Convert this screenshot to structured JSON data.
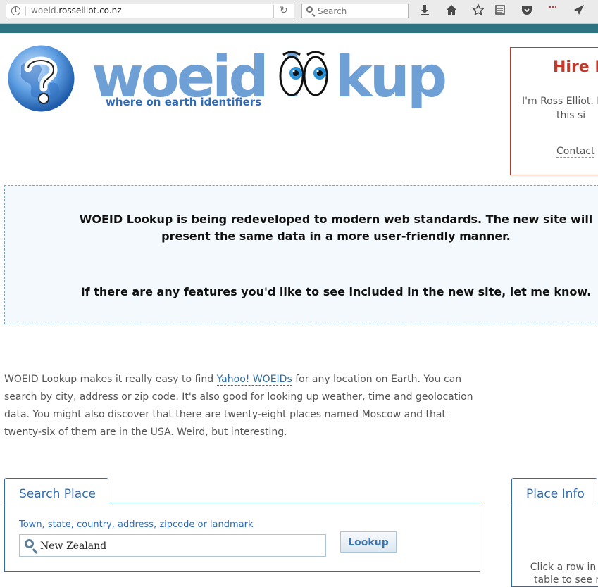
{
  "browser": {
    "url_prefix": "woeid.",
    "url_domain": "rosselliot.co.nz",
    "search_placeholder": "Search",
    "toolbar_icons": [
      "download-icon",
      "home-icon",
      "bookmark-star-icon",
      "reader-view-icon",
      "pocket-icon",
      "extension-icon",
      "send-icon"
    ]
  },
  "header": {
    "logo_word1": "woeid",
    "logo_word2": "kup",
    "tagline": "where on earth identifiers"
  },
  "hire": {
    "title": "Hire M",
    "line1": "I'm Ross Elliot. I",
    "line2": "this si",
    "contact": "Contact"
  },
  "notice": {
    "line1": "WOEID Lookup is being redeveloped to modern web standards. The new site will",
    "line2": "present the same data in a more user-friendly manner.",
    "line3": "If there are any features you'd like to see included in the new site, let me know."
  },
  "intro": {
    "before_link": "WOEID Lookup makes it really easy to find ",
    "link": "Yahoo! WOEIDs",
    "after_link": " for any location on Earth. You can search by city, address or zip code. It's also good for looking up weather, time and geolocation data. You might also discover that there are twenty-eight places named Moscow and that twenty-six of them are in the USA. Weird, but interesting."
  },
  "search": {
    "tab_label": "Search Place",
    "field_label": "Town, state, country, address, zipcode or landmark",
    "value": "New Zealand",
    "button": "Lookup"
  },
  "placeinfo": {
    "tab_label": "Place Info",
    "hint_line1": "Click a row in t",
    "hint_line2": "table to see m"
  },
  "colors": {
    "teal_bar": "#2c7482",
    "brand_blue": "#6ea0d6",
    "accent_red": "#c0392b",
    "panel_blue": "#2e6ab5"
  }
}
